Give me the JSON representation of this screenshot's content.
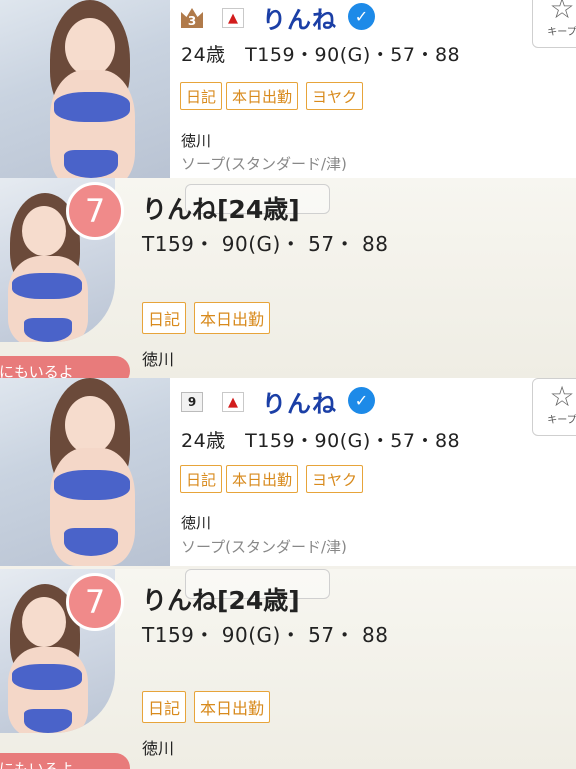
{
  "listings": [
    {
      "rank": "3",
      "rank_style": "crown",
      "up_icon": "up-arrow-icon",
      "name": "りんね",
      "verified_icon": "checkmark-badge-icon",
      "stats": "24歳　T159・90(G)・57・88",
      "tags": [
        "日記",
        "本日出勤",
        "ヨヤク"
      ],
      "area": "徳川",
      "genre": "ソープ(スタンダード/津)",
      "keep": {
        "label": "キープ",
        "icon": "star-icon"
      },
      "detail": {
        "number": "7",
        "name": "りんね[24歳]",
        "stats": "T159・ 90(G)・ 57・ 88",
        "tags": [
          "日記",
          "本日出勤"
        ],
        "area": "徳川",
        "ribbon": "他にもいるよ"
      }
    },
    {
      "rank": "9",
      "rank_style": "box",
      "up_icon": "up-arrow-icon",
      "name": "りんね",
      "verified_icon": "checkmark-badge-icon",
      "stats": "24歳　T159・90(G)・57・88",
      "tags": [
        "日記",
        "本日出勤",
        "ヨヤク"
      ],
      "area": "徳川",
      "genre": "ソープ(スタンダード/津)",
      "keep": {
        "label": "キープ",
        "icon": "star-icon"
      },
      "detail": {
        "number": "7",
        "name": "りんね[24歳]",
        "stats": "T159・ 90(G)・ 57・ 88",
        "tags": [
          "日記",
          "本日出勤"
        ],
        "area": "徳川",
        "ribbon": "他にもいるよ"
      }
    }
  ],
  "colors": {
    "name_blue": "#1b3fa6",
    "verified_blue": "#1d8ae8",
    "tag_orange": "#e7a43a",
    "rank_badge_pink": "#f08a8a",
    "ribbon_pink": "#e87b7b",
    "up_red": "#d21c1c"
  }
}
